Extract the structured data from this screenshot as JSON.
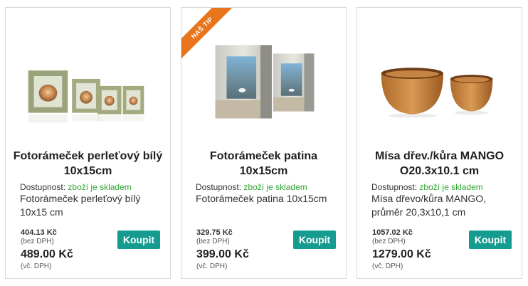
{
  "colors": {
    "accent": "#159b8f",
    "stock": "#2fa52f",
    "ribbon": "#e8741c"
  },
  "products": [
    {
      "title": "Fotorámeček perleťový bílý 10x15cm",
      "availability_label": "Dostupnost:",
      "availability_value": "zboží je skladem",
      "description": "Fotorámeček perleťový bílý 10x15 cm",
      "price_ex_vat": "404.13 Kč",
      "price_ex_vat_note": "(bez DPH)",
      "price_inc_vat": "489.00 Kč",
      "price_inc_vat_note": "(vč. DPH)",
      "buy_label": "Koupit"
    },
    {
      "ribbon": "NAŠ TIP",
      "title": "Fotorámeček patina 10x15cm",
      "availability_label": "Dostupnost:",
      "availability_value": "zboží je skladem",
      "description": "Fotorámeček patina 10x15cm",
      "price_ex_vat": "329.75 Kč",
      "price_ex_vat_note": "(bez DPH)",
      "price_inc_vat": "399.00 Kč",
      "price_inc_vat_note": "(vč. DPH)",
      "buy_label": "Koupit"
    },
    {
      "title": "Mísa dřev./kůra MANGO O20.3x10.1 cm",
      "availability_label": "Dostupnost:",
      "availability_value": "zboží je skladem",
      "description": "Mísa dřevo/kůra MANGO, průměr 20,3x10,1 cm",
      "price_ex_vat": "1057.02 Kč",
      "price_ex_vat_note": "(bez DPH)",
      "price_inc_vat": "1279.00 Kč",
      "price_inc_vat_note": "(vč. DPH)",
      "buy_label": "Koupit"
    }
  ]
}
